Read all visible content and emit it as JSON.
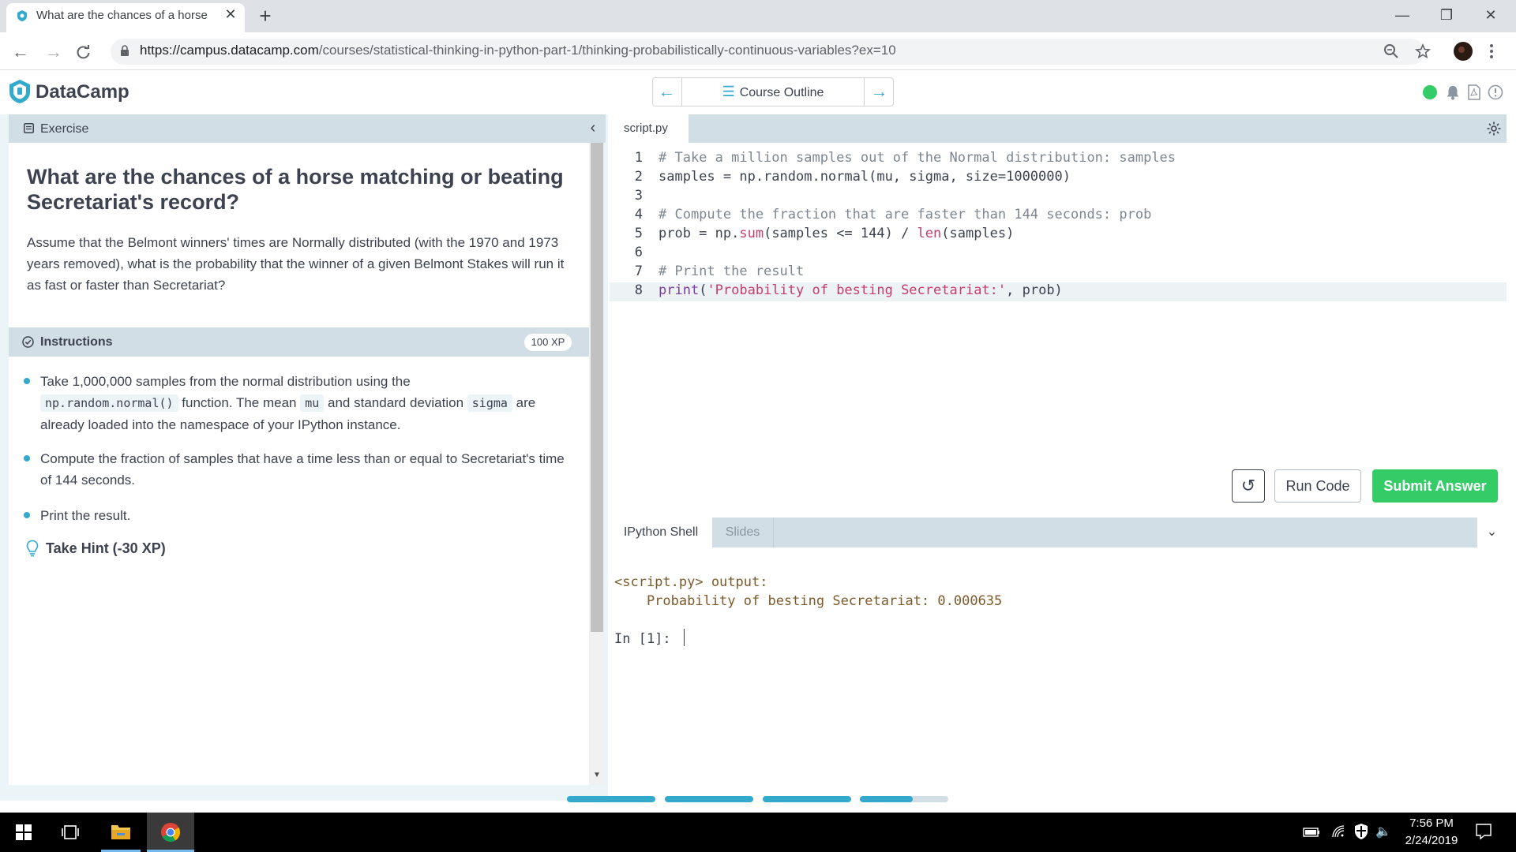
{
  "browser": {
    "tab_title": "What are the chances of a horse",
    "tab_close": "✕",
    "new_tab": "+",
    "url_host": "https://campus.datacamp.com",
    "url_path": "/courses/statistical-thinking-in-python-part-1/thinking-probabilistically-continuous-variables?ex=10",
    "nav": {
      "back": "←",
      "forward": "→",
      "reload": "C"
    },
    "window": {
      "minimize": "—",
      "restore": "❐",
      "close": "✕"
    }
  },
  "header": {
    "brand": "DataCamp",
    "outline_label": "Course Outline",
    "status_color": "#33cc66"
  },
  "exercise": {
    "section_label": "Exercise",
    "title": "What are the chances of a horse matching or beating Secretariat's record?",
    "description": "Assume that the Belmont winners' times are Normally distributed (with the 1970 and 1973 years removed), what is the probability that the winner of a given Belmont Stakes will run it as fast or faster than Secretariat?"
  },
  "instructions": {
    "section_label": "Instructions",
    "xp": "100 XP",
    "items": [
      {
        "a": "Take 1,000,000 samples from the normal distribution using the",
        "code1": "np.random.normal()",
        "b": " function. The mean ",
        "code2": "mu",
        "c": " and standard deviation ",
        "code3": "sigma",
        "d": " are already loaded into the namespace of your IPython instance."
      },
      {
        "text": "Compute the fraction of samples that have a time less than or equal to Secretariat's time of 144 seconds."
      },
      {
        "text": "Print the result."
      }
    ],
    "hint": "Take Hint (-30 XP)"
  },
  "editor": {
    "tab": "script.py",
    "lines": [
      {
        "n": "1",
        "comment": "# Take a million samples out of the Normal distribution: samples"
      },
      {
        "n": "2",
        "a": "samples = np.random.normal(mu, sigma, size=1000000)"
      },
      {
        "n": "3"
      },
      {
        "n": "4",
        "comment": "# Compute the fraction that are faster than 144 seconds: prob"
      },
      {
        "n": "5",
        "a": "prob = np.",
        "fn": "sum",
        "b": "(samples <= 144) / ",
        "fn2": "len",
        "c": "(samples)"
      },
      {
        "n": "6"
      },
      {
        "n": "7",
        "comment": "# Print the result"
      },
      {
        "n": "8",
        "kw": "print",
        "a": "(",
        "str": "'Probability of besting Secretariat:'",
        "b": ", prob)"
      }
    ],
    "run_label": "Run Code",
    "submit_label": "Submit Answer"
  },
  "shell": {
    "tab_active": "IPython Shell",
    "tab_inactive": "Slides",
    "output_header": "<script.py> output:",
    "output_line": "    Probability of besting Secretariat: 0.000635",
    "prompt": "In [1]:"
  },
  "progress": {
    "segments": 4,
    "last_fill": 0.6
  },
  "taskbar": {
    "time": "7:56 PM",
    "date": "2/24/2019"
  }
}
